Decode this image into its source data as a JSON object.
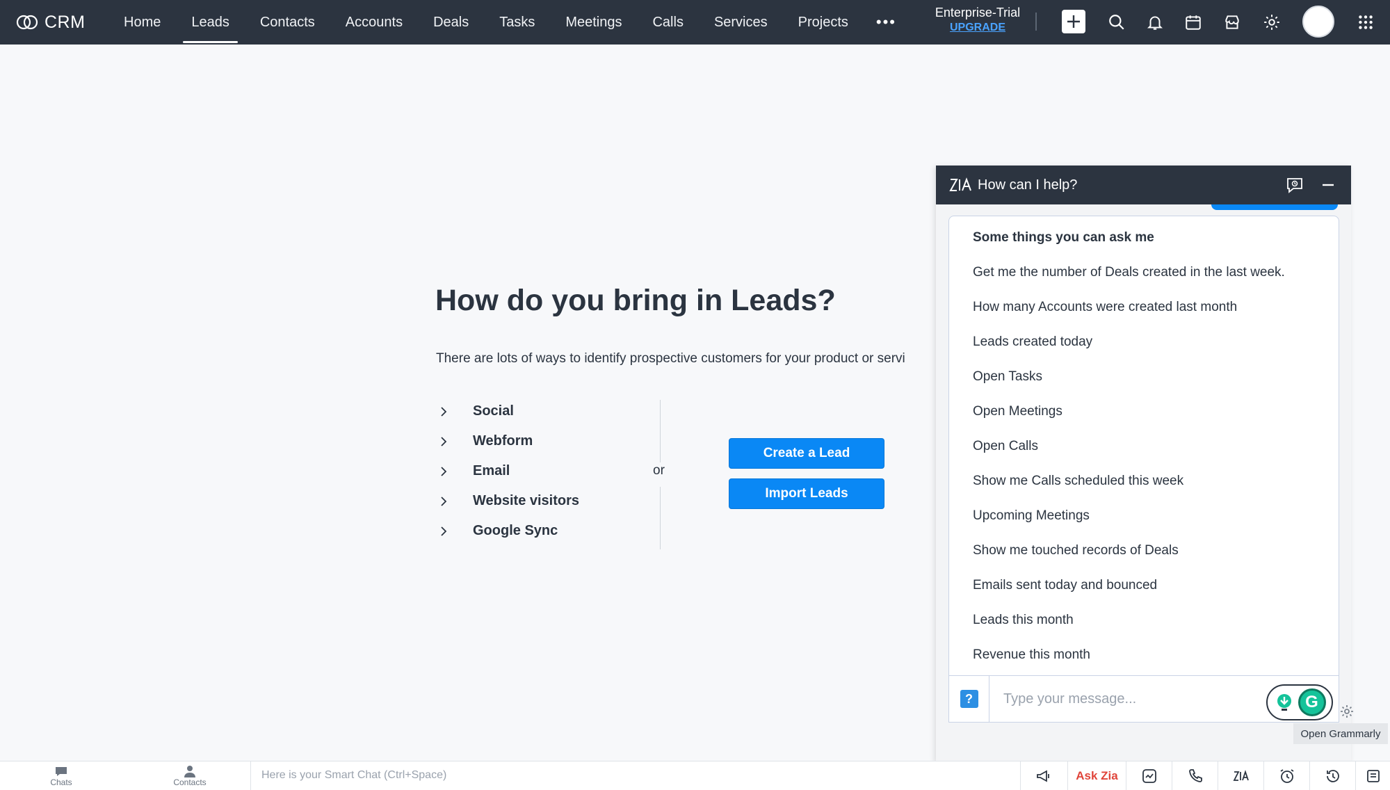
{
  "brand": {
    "name": "CRM"
  },
  "nav": {
    "items": [
      {
        "label": "Home",
        "active": false
      },
      {
        "label": "Leads",
        "active": true
      },
      {
        "label": "Contacts",
        "active": false
      },
      {
        "label": "Accounts",
        "active": false
      },
      {
        "label": "Deals",
        "active": false
      },
      {
        "label": "Tasks",
        "active": false
      },
      {
        "label": "Meetings",
        "active": false
      },
      {
        "label": "Calls",
        "active": false
      },
      {
        "label": "Services",
        "active": false
      },
      {
        "label": "Projects",
        "active": false
      }
    ],
    "more": "•••",
    "edition": "Enterprise-Trial",
    "upgrade": "UPGRADE"
  },
  "main": {
    "title": "How do you bring in Leads?",
    "description": "There are lots of ways to identify prospective customers for your product or servi",
    "sources": [
      "Social",
      "Webform",
      "Email",
      "Website visitors",
      "Google Sync"
    ],
    "or": "or",
    "create_button": "Create a Lead",
    "import_button": "Import Leads"
  },
  "zia": {
    "title": "How can I help?",
    "list_heading": "Some things you can ask me",
    "suggestions": [
      "Get me the number of Deals created in the last week.",
      "How many Accounts were created last month",
      "Leads created today",
      "Open Tasks",
      "Open Meetings",
      "Open Calls",
      "Show me Calls scheduled this week",
      "Upcoming Meetings",
      "Show me touched records of Deals",
      "Emails sent today and bounced",
      "Leads this month",
      "Revenue this month"
    ],
    "help_glyph": "?",
    "input_placeholder": "Type your message...",
    "grammarly_letter": "G",
    "grammarly_tooltip": "Open Grammarly"
  },
  "bottombar": {
    "chats": "Chats",
    "contacts": "Contacts",
    "smart_chat": "Here is your Smart Chat (Ctrl+Space)",
    "ask_zia": "Ask Zia"
  },
  "colors": {
    "nav_bg": "#2c3440",
    "primary": "#0a88f5",
    "ask_zia": "#e0443a",
    "grammarly": "#15c39a"
  }
}
